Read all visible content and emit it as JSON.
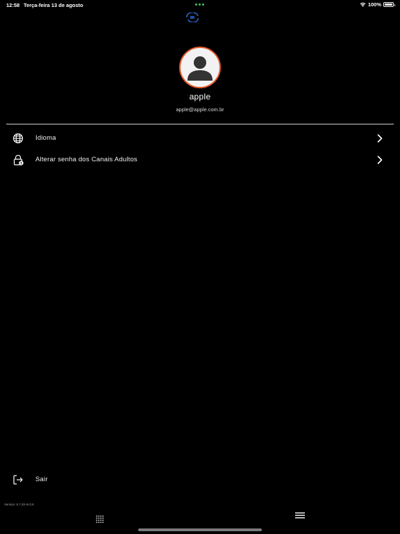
{
  "status_bar": {
    "time": "12:58",
    "date": "Terça-feira 13 de agosto",
    "battery": "100%"
  },
  "profile": {
    "name": "apple",
    "email": "apple@apple.com.br",
    "avatar_border_color": "#e2572a"
  },
  "menu": {
    "items": [
      {
        "label": "Idioma",
        "icon": "globe-icon"
      },
      {
        "label": "Alterar senha dos Canais Adultos",
        "icon": "lock-user-icon"
      }
    ]
  },
  "logout": {
    "label": "Sair",
    "icon": "logout-icon"
  },
  "footer": {
    "version": "Version: 5.7.20+6.0.8"
  },
  "tab_bar": {
    "items": [
      {
        "icon": "grid-icon"
      },
      {
        "icon": "hamburger-menu-icon"
      }
    ]
  }
}
